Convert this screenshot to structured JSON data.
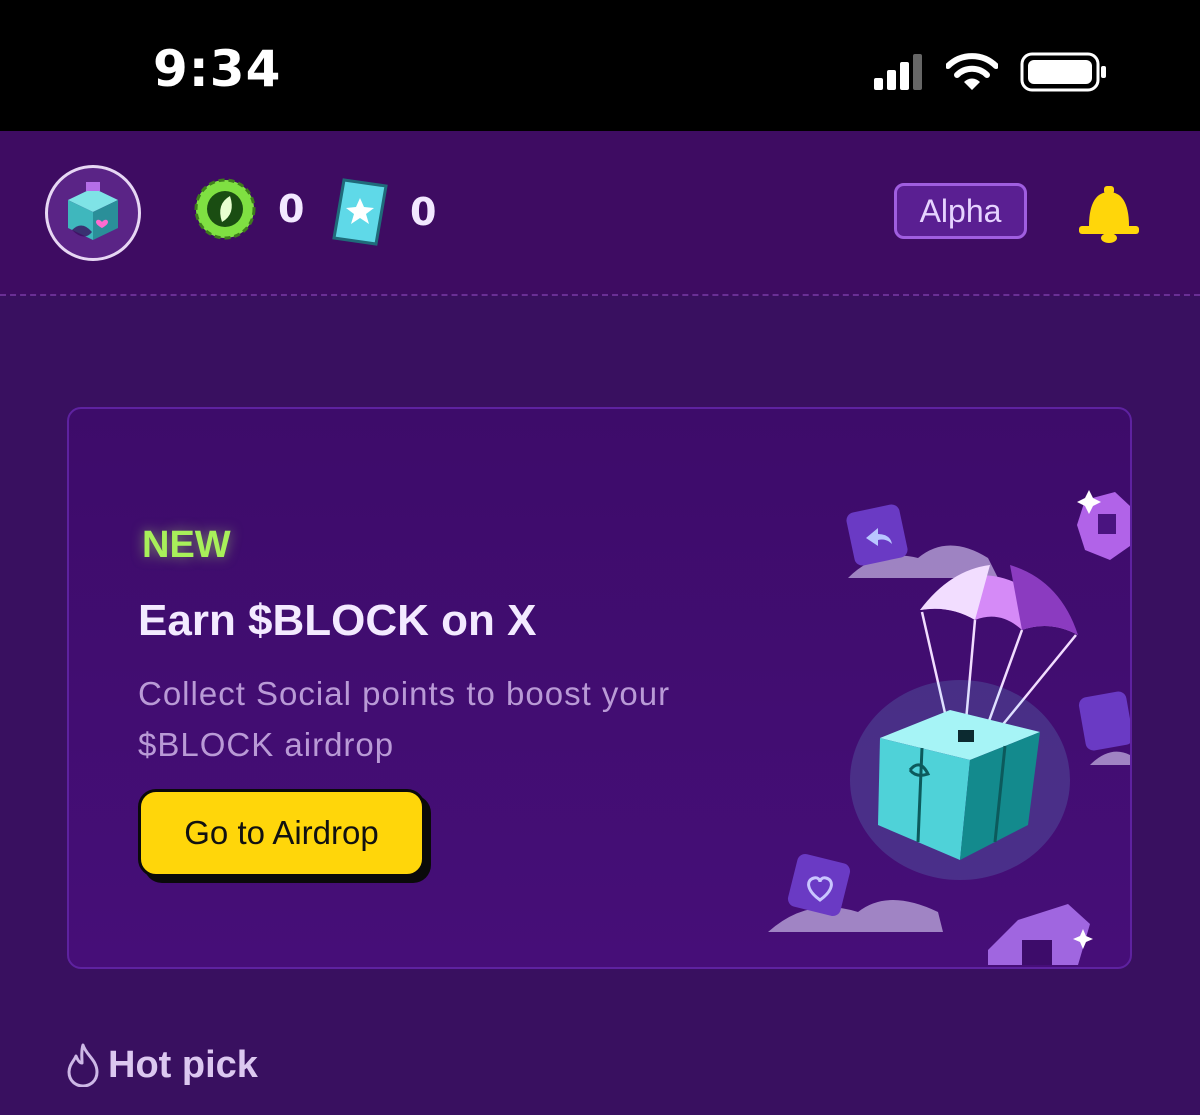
{
  "status_bar": {
    "time": "9:34",
    "icons": [
      "cellular-signal-icon",
      "wifi-icon",
      "battery-icon"
    ]
  },
  "header": {
    "avatar_icon": "cube-avatar-icon",
    "currencies": [
      {
        "icon": "green-coin-icon",
        "value": "0"
      },
      {
        "icon": "ticket-star-icon",
        "value": "0"
      }
    ],
    "badge_label": "Alpha",
    "notification_icon": "bell-icon"
  },
  "promo_card": {
    "tag": "NEW",
    "title": "Earn $BLOCK on X",
    "description": "Collect Social points to boost your $BLOCK airdrop",
    "button_label": "Go to Airdrop",
    "illustration": "parachute-gift-cube-illustration"
  },
  "section": {
    "icon": "flame-icon",
    "title": "Hot pick"
  },
  "colors": {
    "background": "#391060",
    "accent_yellow": "#ffd60a",
    "new_green": "#a8f05a",
    "badge_purple": "#a05ee0"
  }
}
